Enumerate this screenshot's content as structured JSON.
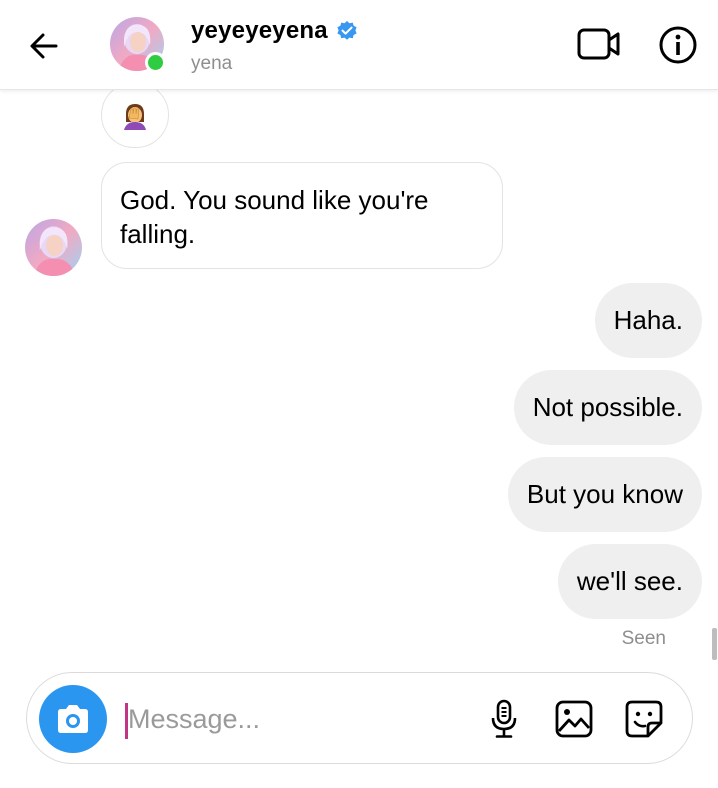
{
  "header": {
    "username": "yeyeyeyena",
    "handle": "yena",
    "verified_icon": "verified-badge-icon",
    "back_icon": "back-arrow-icon",
    "video_icon": "video-call-icon",
    "info_icon": "info-icon",
    "online_color": "#2ecc40",
    "verified_color": "#3897f0"
  },
  "messages": {
    "reaction_emoji": "🤦‍♀️",
    "incoming": "God. You sound like you're falling.",
    "outgoing": [
      "Haha.",
      "Not possible.",
      "But you know",
      "we'll see."
    ]
  },
  "status": {
    "seen": "Seen"
  },
  "composer": {
    "placeholder": "Message...",
    "camera_icon": "camera-icon",
    "mic_icon": "microphone-icon",
    "gallery_icon": "gallery-icon",
    "sticker_icon": "sticker-icon",
    "camera_color": "#2a96f0"
  }
}
